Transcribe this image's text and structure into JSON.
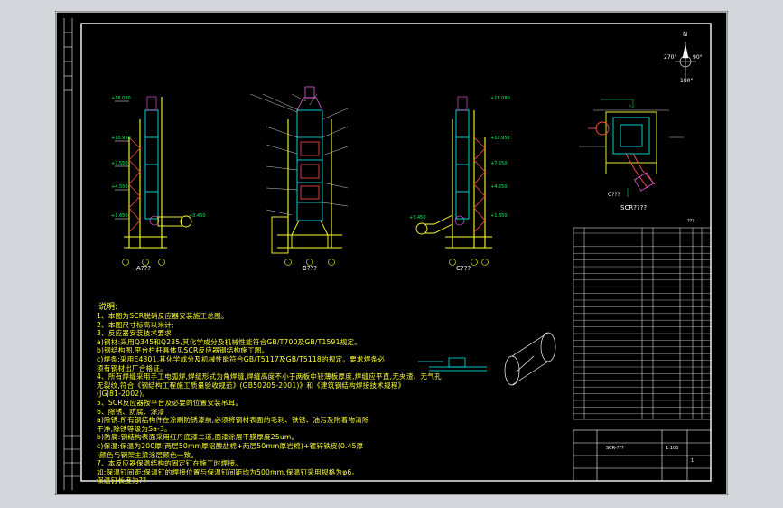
{
  "compass": {
    "north": "N",
    "east": "90°",
    "west": "270°",
    "south": "180°"
  },
  "views": {
    "a_label": "A???",
    "b_label": "B???",
    "c_label": "C???",
    "plan_label": "SCR????",
    "plan_sub": "C???"
  },
  "notes": {
    "title": "说明:",
    "lines": [
      "1、本图为SCR脱硝反应器安装施工总图。",
      "2、本图尺寸标高以米计;",
      "3、反应器安装技术要求",
      "a)钢材:采用Q345和Q235,其化学成分及机械性能符合GB/T700及GB/T1591规定。",
      "b)钢结构图,平台栏杆具体见SCR反应器钢结构施工图。",
      "c)焊条:采用E4301,其化学成分及机械性能符合GB/T5117及GB/T5118的规定。要求焊条必",
      "须有钢材出厂合格证。",
      "4、所有焊缝采用手工电弧焊,焊缝形式为角焊缝,焊缝高度不小于两板中较薄板厚度,焊缝应平直,无夹渣、无气孔",
      "无裂纹,符合《钢结构工程施工质量验收规范》(GB50205-2001)》和《建筑钢结构焊接技术规程》",
      "(JGJ81-2002)。",
      "5、SCR反应器按平台及必要的位置安装吊耳。",
      "6、除锈、防腐、涂漆",
      "a)除锈:所有钢结构件在涂刷防锈漆前,必须将钢材表面的毛刺、铁锈、油污及附着物清除",
      "干净,除锈等级为Sa-3。",
      "b)防腐:钢结构表面采用红丹底漆二道,面漆涂层干膜厚度25um。",
      "c)保温:保温为200厚(两层50mm厚铝酸盐棉+两层50mm厚岩棉)+镀锌铁皮(0.45厚",
      ")颜色与钢架主梁涂层颜色一致。",
      "7、本反应器保温结构的固定钉在施工时焊接。",
      "如:保温钉间距:保温钉的焊接位置与保温钉间距均为500mm,保温钉采用规格为φ6。",
      "保温钉长度为??"
    ]
  },
  "title_block": {
    "drawing_no": "SCR-???",
    "scale": "1:100",
    "sheet": "1"
  },
  "parts_table": {
    "header_note": "???"
  }
}
